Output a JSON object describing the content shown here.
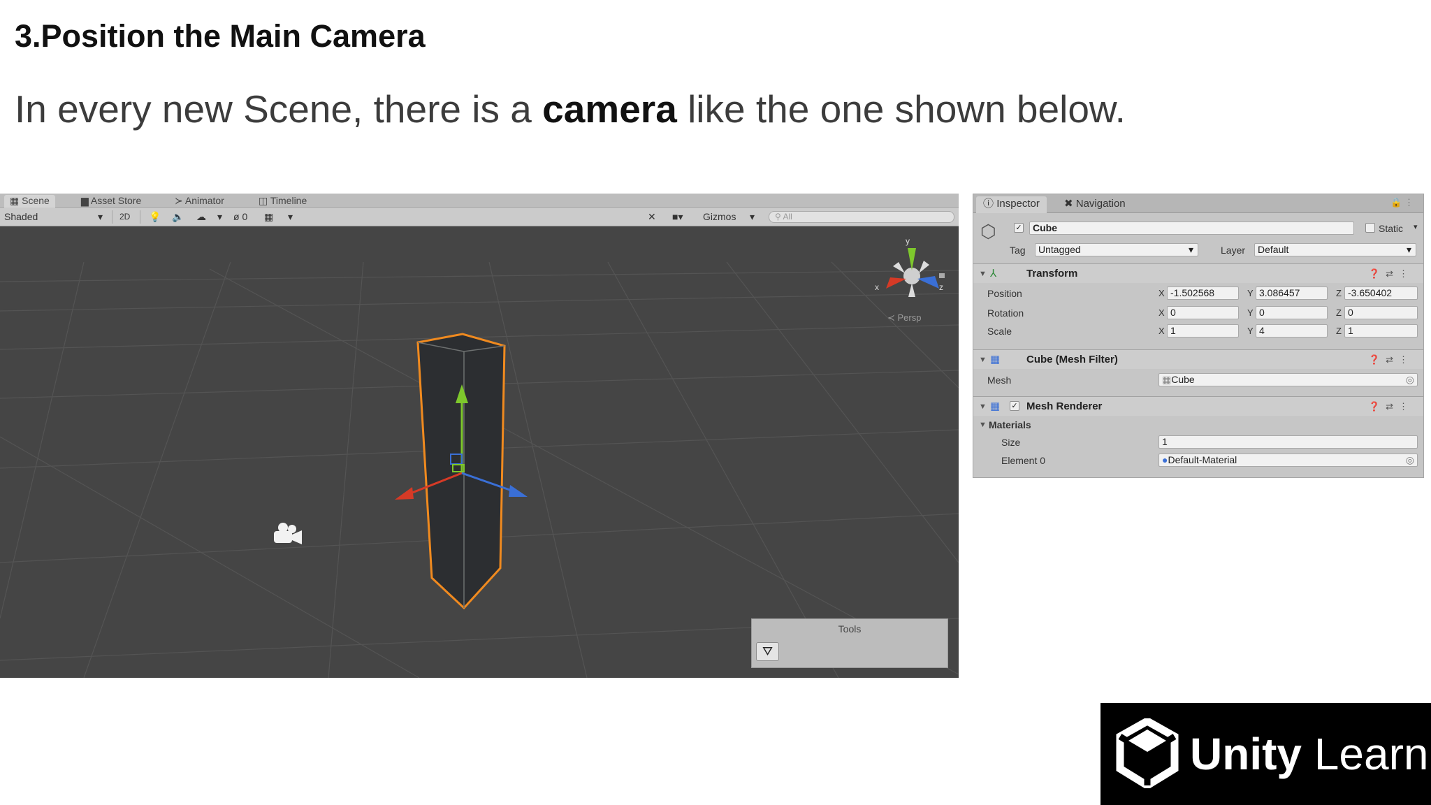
{
  "slide": {
    "title": "3.Position the Main Camera",
    "subtitle_before": "In every new Scene, there is a ",
    "subtitle_bold": "camera",
    "subtitle_after": " like the one shown below."
  },
  "scene_view": {
    "tabs": [
      "Scene",
      "Asset Store",
      "Animator",
      "Timeline"
    ],
    "active_tab": "Scene",
    "toolbar": {
      "shading_mode": "Shaded",
      "mode_2d": "2D",
      "effects_count": "0",
      "gizmos": "Gizmos",
      "search_placeholder": "All"
    },
    "projection_label": "Persp",
    "gizmo_axes": {
      "x": "x",
      "y": "y",
      "z": "z"
    },
    "tools_overlay": {
      "title": "Tools"
    },
    "colors": {
      "background": "#454545",
      "selection_outline": "#f08a1f",
      "x_axis": "#d63a26",
      "y_axis": "#7ec82c",
      "z_axis": "#3a6fd6"
    }
  },
  "inspector": {
    "tabs": [
      "Inspector",
      "Navigation"
    ],
    "active_tab": "Inspector",
    "object_name": "Cube",
    "static_label": "Static",
    "tag_label": "Tag",
    "tag_value": "Untagged",
    "layer_label": "Layer",
    "layer_value": "Default",
    "transform": {
      "title": "Transform",
      "rows": [
        {
          "label": "Position",
          "x": "-1.502568",
          "y": "3.086457",
          "z": "-3.650402"
        },
        {
          "label": "Rotation",
          "x": "0",
          "y": "0",
          "z": "0"
        },
        {
          "label": "Scale",
          "x": "1",
          "y": "4",
          "z": "1"
        }
      ]
    },
    "mesh_filter": {
      "title": "Cube (Mesh Filter)",
      "mesh_label": "Mesh",
      "mesh_value": "Cube"
    },
    "mesh_renderer": {
      "title": "Mesh Renderer",
      "materials_label": "Materials",
      "size_label": "Size",
      "size_value": "1",
      "element_label": "Element 0",
      "element_value": "Default-Material"
    }
  },
  "logo": {
    "brand_bold": "Unity",
    "brand_light": " Learn"
  }
}
